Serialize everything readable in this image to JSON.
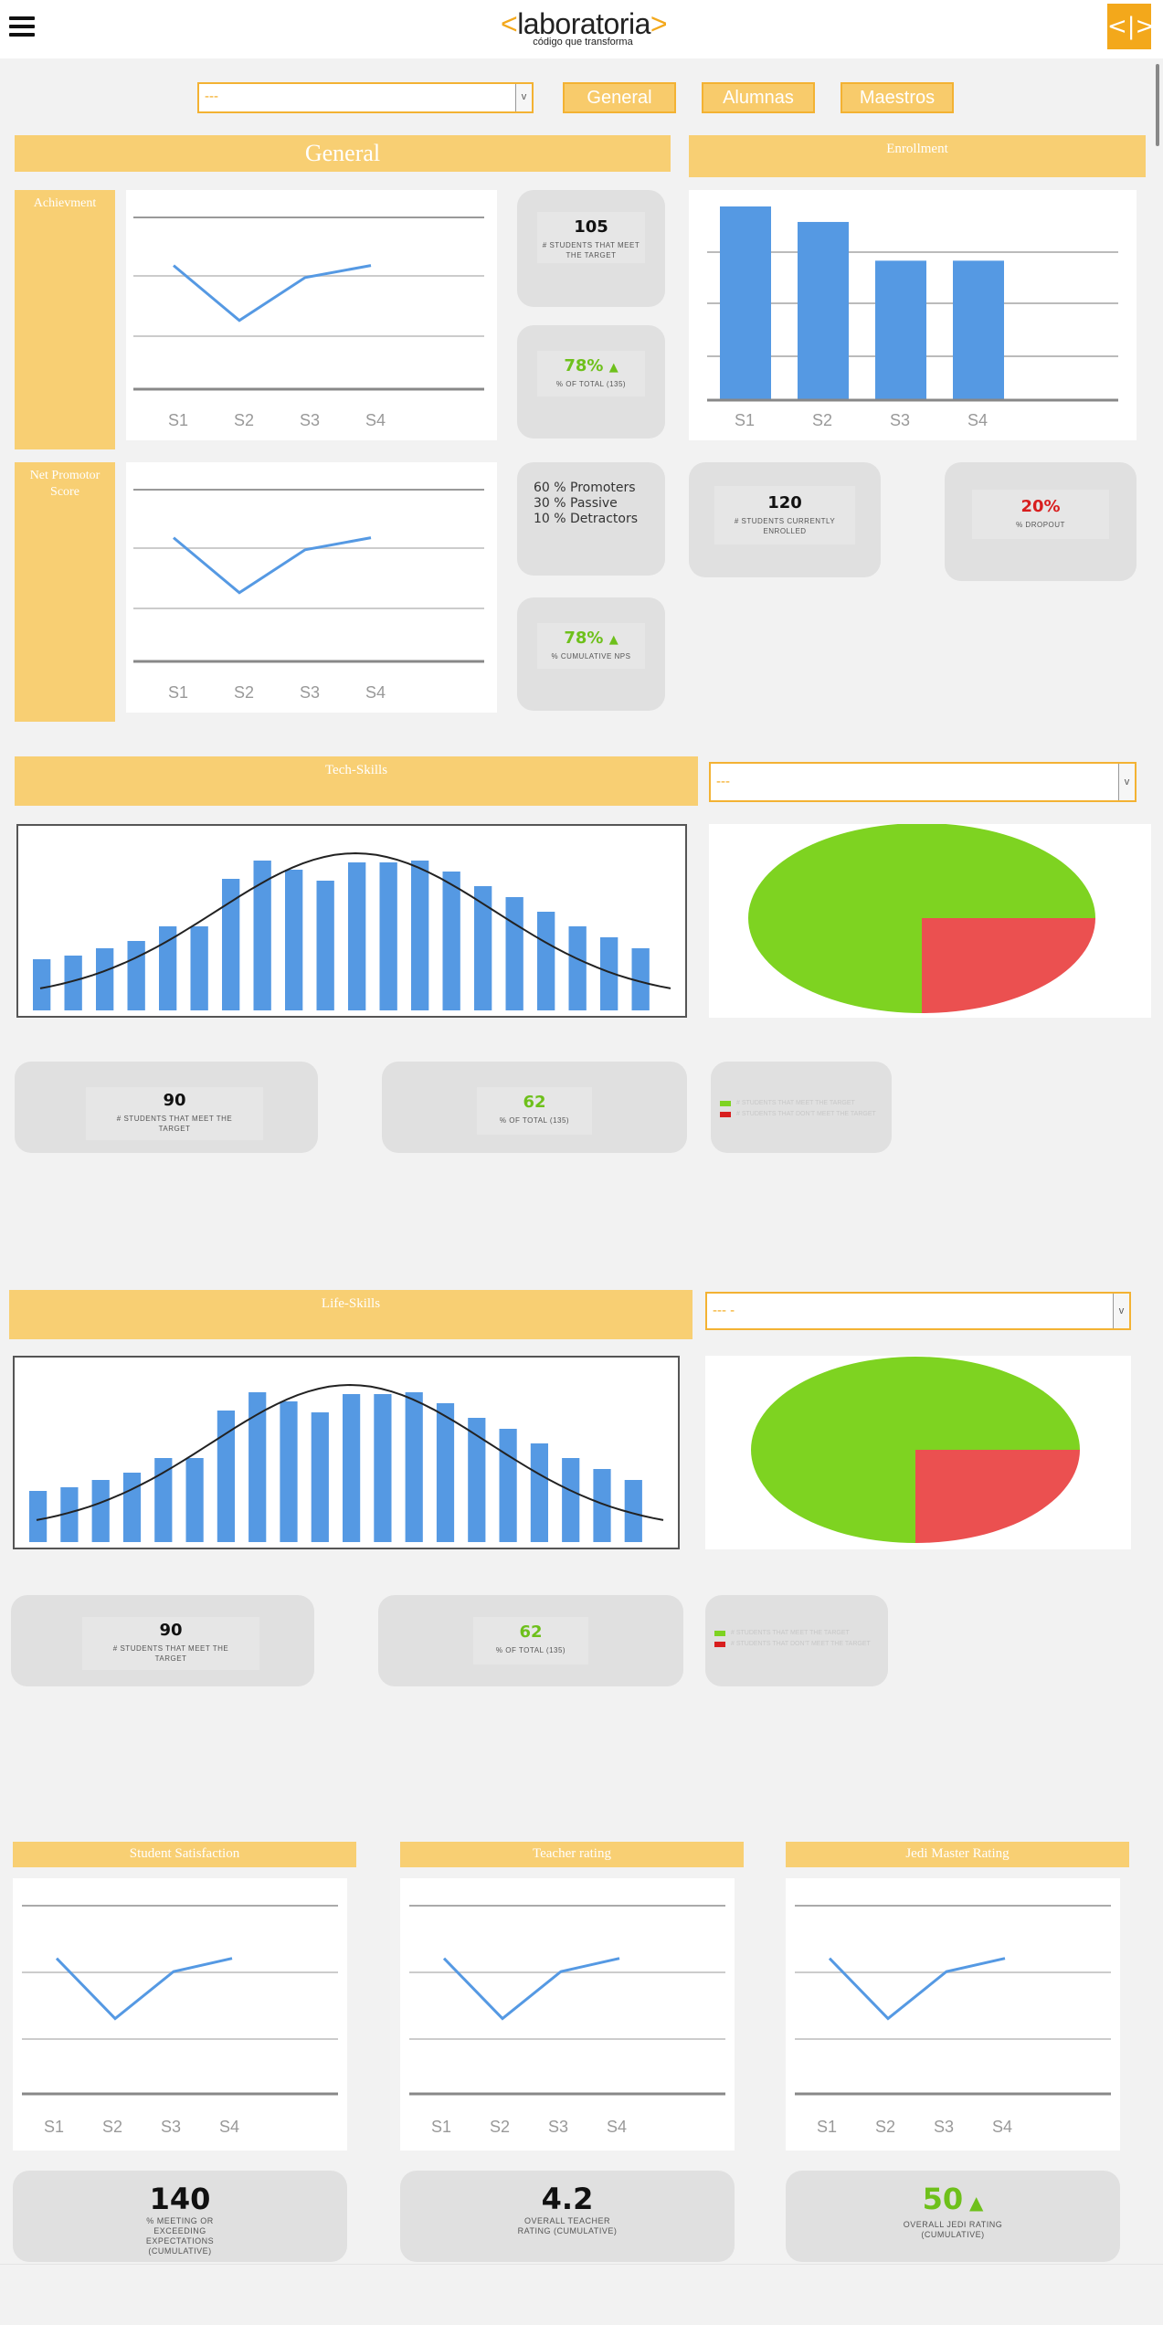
{
  "header": {
    "logo_left": "<",
    "logo_text": "laboratoria",
    "logo_right": ">",
    "logo_tagline": "código que transforma",
    "code_button": "<|>"
  },
  "filters": {
    "main_select": "---",
    "buttons": [
      "General",
      "Alumnas",
      "Maestros"
    ]
  },
  "general": {
    "title": "General",
    "achievement": {
      "label": "Achievment",
      "chart_labels": [
        "S1",
        "S2",
        "S3",
        "S4"
      ],
      "students_value": "105",
      "students_label": "# STUDENTS THAT MEET THE TARGET",
      "pct_value": "78%",
      "pct_label": "% OF TOTAL (135)"
    },
    "nps": {
      "label": "Net Promotor Score",
      "chart_labels": [
        "S1",
        "S2",
        "S3",
        "S4"
      ],
      "lines": [
        "60 %  Promoters",
        "30 %  Passive",
        "10 %  Detractors"
      ],
      "pct_value": "78%",
      "pct_label": "% CUMULATIVE NPS"
    }
  },
  "enrollment": {
    "title": "Enrollment",
    "chart_labels": [
      "S1",
      "S2",
      "S3",
      "S4"
    ],
    "students_value": "120",
    "students_label": "# STUDENTS CURRENTLY ENROLLED",
    "dropout_value": "20%",
    "dropout_label": "% DROPOUT"
  },
  "tech": {
    "title": "Tech-Skills",
    "select": "---",
    "students_value": "90",
    "students_label": "# STUDENTS THAT MEET THE TARGET",
    "pct_value": "62",
    "pct_label": "% OF TOTAL (135)",
    "legend": [
      "# STUDENTS THAT MEET THE TARGET",
      "# STUDENTS THAT DON'T MEET THE TARGET"
    ]
  },
  "life": {
    "title": "Life-Skills",
    "select": "--- -",
    "students_value": "90",
    "students_label": "# STUDENTS THAT MEET THE TARGET",
    "pct_value": "62",
    "pct_label": "% OF TOTAL (135)",
    "legend": [
      "# STUDENTS THAT MEET THE TARGET",
      "# STUDENTS THAT DON'T MEET THE TARGET"
    ]
  },
  "ratings": [
    {
      "title": "Student Satisfaction",
      "value": "140",
      "label": "% MEETING OR EXCEEDING EXPECTATIONS (CUMULATIVE)"
    },
    {
      "title": "Teacher rating",
      "value": "4.2",
      "label": "OVERALL TEACHER RATING (CUMULATIVE)"
    },
    {
      "title": "Jedi Master Rating",
      "value": "50",
      "label": "OVERALL JEDI RATING (CUMULATIVE)"
    }
  ],
  "chart_labels": [
    "S1",
    "S2",
    "S3",
    "S4"
  ],
  "chart_data": [
    {
      "type": "bar",
      "categories": [
        "S1",
        "S2",
        "S3",
        "S4"
      ],
      "values": [
        100,
        92,
        72,
        72
      ]
    },
    {
      "type": "line",
      "categories": [
        "S1",
        "S2",
        "S3",
        "S4"
      ],
      "values": [
        72,
        40,
        65,
        72
      ]
    },
    {
      "type": "line",
      "categories": [
        "S1",
        "S2",
        "S3",
        "S4"
      ],
      "values": [
        72,
        40,
        65,
        72
      ]
    },
    {
      "type": "bar",
      "values": [
        28,
        30,
        34,
        38,
        46,
        46,
        72,
        82,
        77,
        71,
        81,
        81,
        82,
        76,
        68,
        62,
        54,
        46,
        40,
        34
      ]
    },
    {
      "type": "pie",
      "values": [
        75,
        25
      ],
      "colors": [
        "#7ed321",
        "#eb5050"
      ]
    },
    {
      "type": "bar",
      "values": [
        28,
        30,
        34,
        38,
        46,
        46,
        72,
        82,
        77,
        71,
        81,
        81,
        82,
        76,
        68,
        62,
        54,
        46,
        40,
        34
      ]
    },
    {
      "type": "pie",
      "values": [
        75,
        25
      ],
      "colors": [
        "#7ed321",
        "#eb5050"
      ]
    }
  ],
  "colors": {
    "accent": "#f8cf73",
    "orange": "#f3a81b",
    "bar": "#5599e3",
    "green": "#6ec01b",
    "red": "#d81e1e"
  }
}
